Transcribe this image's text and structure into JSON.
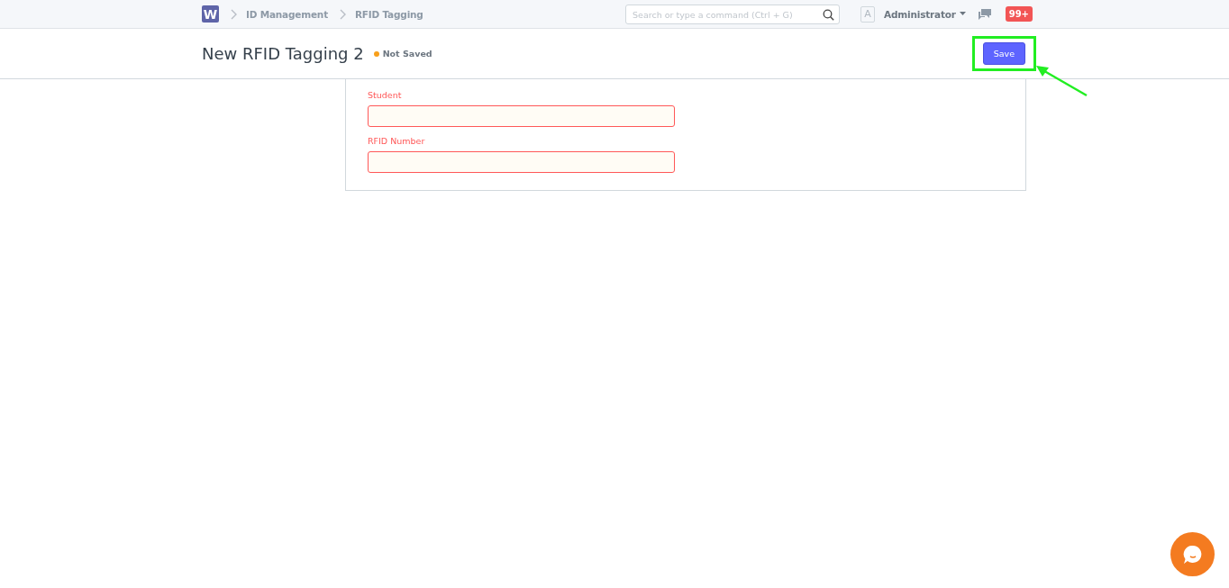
{
  "navbar": {
    "logo": "W",
    "breadcrumbs": [
      "ID Management",
      "RFID Tagging"
    ],
    "search": {
      "placeholder": "Search or type a command (Ctrl + G)"
    },
    "avatar": "A",
    "user": "Administrator",
    "notifications": "99+"
  },
  "page_head": {
    "title": "New RFID Tagging 2",
    "status": "Not Saved",
    "save_button": "Save",
    "save_highlighted": true
  },
  "form": {
    "fields": [
      {
        "label": "Student",
        "invalid": true
      },
      {
        "label": "RFID Number",
        "invalid": true
      }
    ]
  }
}
